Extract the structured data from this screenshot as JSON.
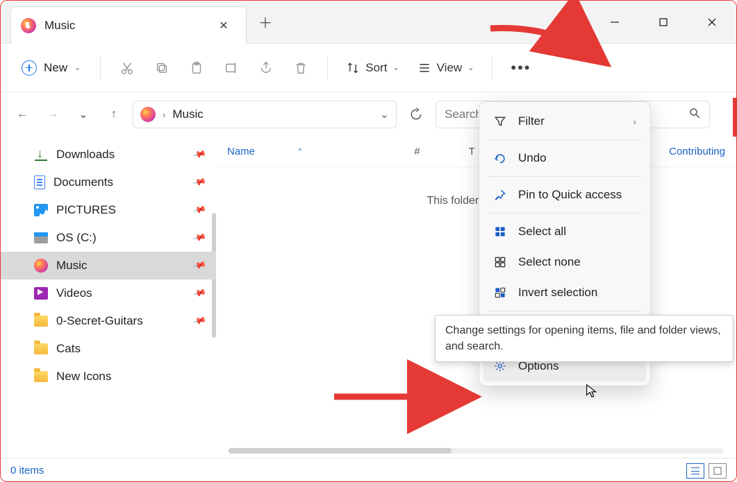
{
  "tab": {
    "title": "Music"
  },
  "toolbar": {
    "new_label": "New",
    "sort_label": "Sort",
    "view_label": "View"
  },
  "breadcrumb": {
    "location": "Music"
  },
  "search": {
    "placeholder": "Search Music"
  },
  "columns": {
    "name": "Name",
    "number": "#",
    "title_col": "T",
    "contributing": "Contributing"
  },
  "empty_message": "This folder is empty.",
  "sidebar": {
    "items": [
      {
        "label": "Downloads",
        "type": "downloads"
      },
      {
        "label": "Documents",
        "type": "documents"
      },
      {
        "label": "PICTURES",
        "type": "pictures"
      },
      {
        "label": "OS (C:)",
        "type": "drive"
      },
      {
        "label": "Music",
        "type": "music",
        "selected": true
      },
      {
        "label": "Videos",
        "type": "videos"
      },
      {
        "label": "0-Secret-Guitars",
        "type": "folder"
      },
      {
        "label": "Cats",
        "type": "folder"
      },
      {
        "label": "New Icons",
        "type": "folder"
      }
    ]
  },
  "context_menu": {
    "filter": "Filter",
    "undo": "Undo",
    "pin": "Pin to Quick access",
    "select_all": "Select all",
    "select_none": "Select none",
    "invert": "Invert selection",
    "options": "Options"
  },
  "tooltip_text": "Change settings for opening items, file and folder views, and search.",
  "status": {
    "items": "0 items"
  }
}
